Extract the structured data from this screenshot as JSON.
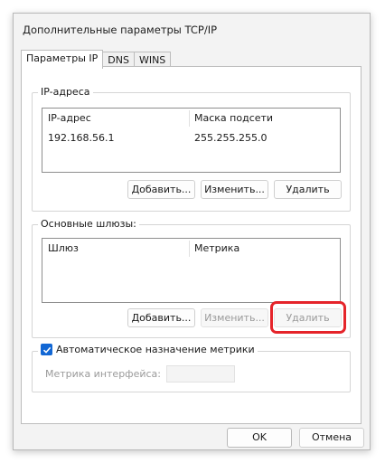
{
  "window": {
    "title": "Дополнительные параметры TCP/IP"
  },
  "tabs": [
    {
      "label": "Параметры IP"
    },
    {
      "label": "DNS"
    },
    {
      "label": "WINS"
    }
  ],
  "ip_section": {
    "label": "IP-адреса",
    "columns": [
      "IP-адрес",
      "Маска подсети"
    ],
    "rows": [
      {
        "ip": "192.168.56.1",
        "mask": "255.255.255.0"
      }
    ],
    "buttons": {
      "add": "Добавить...",
      "edit": "Изменить...",
      "delete": "Удалить"
    }
  },
  "gateway_section": {
    "label": "Основные шлюзы:",
    "columns": [
      "Шлюз",
      "Метрика"
    ],
    "buttons": {
      "add": "Добавить...",
      "edit": "Изменить...",
      "delete": "Удалить"
    },
    "highlight_color": "#e5242a"
  },
  "metric_section": {
    "checkbox_label": "Автоматическое назначение метрики",
    "checkbox_checked": true,
    "interface_metric_label": "Метрика интерфейса:",
    "interface_metric_value": ""
  },
  "footer": {
    "ok": "OK",
    "cancel": "Отмена"
  }
}
